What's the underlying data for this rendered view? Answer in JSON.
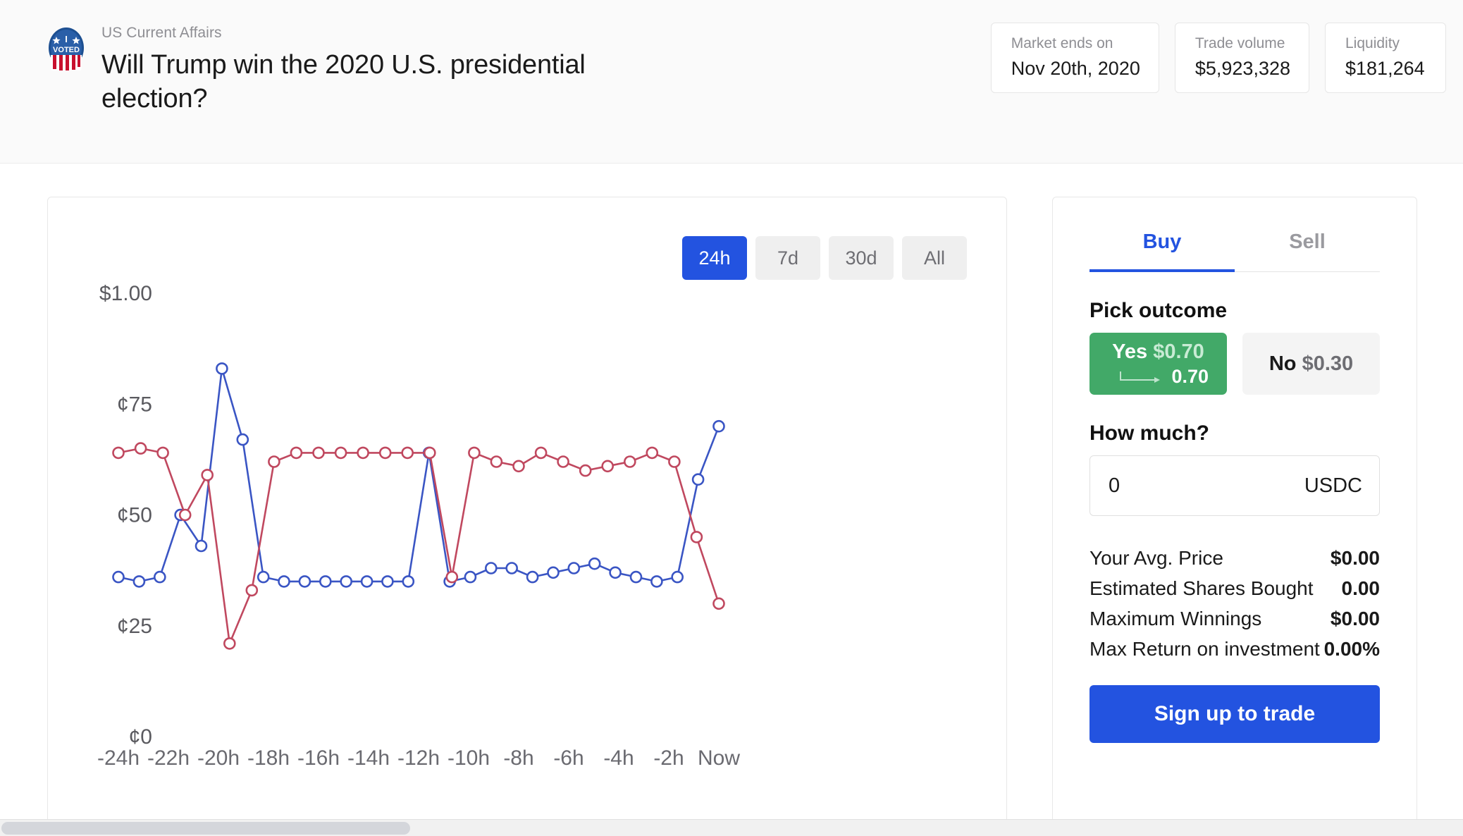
{
  "header": {
    "badge_icon": "i-voted-badge-icon",
    "category": "US Current Affairs",
    "title": "Will Trump win the 2020 U.S. presidential election?",
    "stats": [
      {
        "label": "Market ends on",
        "value": "Nov 20th, 2020"
      },
      {
        "label": "Trade volume",
        "value": "$5,923,328"
      },
      {
        "label": "Liquidity",
        "value": "$181,264"
      }
    ]
  },
  "chart_panel": {
    "ranges": [
      {
        "label": "24h",
        "active": true
      },
      {
        "label": "7d",
        "active": false
      },
      {
        "label": "30d",
        "active": false
      },
      {
        "label": "All",
        "active": false
      }
    ]
  },
  "trade_panel": {
    "tabs": [
      {
        "label": "Buy",
        "active": true
      },
      {
        "label": "Sell",
        "active": false
      }
    ],
    "pick_outcome_label": "Pick outcome",
    "outcomes": [
      {
        "name": "Yes",
        "price": "$0.70",
        "shares": "0.70",
        "selected": true
      },
      {
        "name": "No",
        "price": "$0.30",
        "shares": "",
        "selected": false
      }
    ],
    "how_much_label": "How much?",
    "amount_value": "0",
    "amount_placeholder": "0",
    "amount_unit": "USDC",
    "summary": [
      {
        "label": "Your Avg. Price",
        "value": "$0.00"
      },
      {
        "label": "Estimated Shares Bought",
        "value": "0.00"
      },
      {
        "label": "Maximum Winnings",
        "value": "$0.00"
      },
      {
        "label": "Max Return on investment",
        "value": "0.00%"
      }
    ],
    "cta_label": "Sign up to trade"
  },
  "colors": {
    "brand_blue": "#2353e0",
    "yes_green": "#42a968",
    "series_yes": "#3a55c4",
    "series_no": "#c0485f"
  },
  "chart_data": {
    "type": "line",
    "title": "",
    "xlabel": "",
    "ylabel": "",
    "ylim": [
      0,
      100
    ],
    "ytick_labels": [
      "$1.00",
      "¢75",
      "¢50",
      "¢25",
      "¢0"
    ],
    "ytick_values": [
      100,
      75,
      50,
      25,
      0
    ],
    "xtick_labels": [
      "-24h",
      "-22h",
      "-20h",
      "-18h",
      "-16h",
      "-14h",
      "-12h",
      "-10h",
      "-8h",
      "-6h",
      "-4h",
      "-2h",
      "Now"
    ],
    "xtick_values": [
      -24,
      -22,
      -20,
      -18,
      -16,
      -14,
      -12,
      -10,
      -8,
      -6,
      -4,
      -2,
      0
    ],
    "x": [
      -24,
      -23,
      -22,
      -21,
      -20,
      -19.3,
      -18.6,
      -18,
      -17.3,
      -16.6,
      -16,
      -15.3,
      -14.6,
      -14,
      -13.3,
      -12.6,
      -12.3,
      -12,
      -11.4,
      -10.8,
      -10.2,
      -9.6,
      -9,
      -8.4,
      -7.8,
      -7.2,
      -6.6,
      -6,
      -5.4,
      -4.8,
      -4.2,
      -3.6,
      -3,
      -2.4,
      -1.8,
      -1.2,
      -0.6,
      0
    ],
    "grid": false,
    "legend": false,
    "series": [
      {
        "name": "Yes",
        "color": "#3a55c4",
        "values": [
          36,
          35,
          36,
          50,
          43,
          83,
          67,
          36,
          35,
          35,
          35,
          35,
          35,
          35,
          35,
          64,
          35,
          36,
          38,
          38,
          36,
          37,
          38,
          39,
          37,
          36,
          35,
          36,
          58,
          70
        ]
      },
      {
        "name": "No",
        "color": "#c0485f",
        "values": [
          64,
          65,
          64,
          50,
          59,
          21,
          33,
          62,
          64,
          64,
          64,
          64,
          64,
          64,
          64,
          36,
          64,
          62,
          61,
          64,
          62,
          60,
          61,
          62,
          64,
          62,
          45,
          30
        ]
      }
    ]
  }
}
